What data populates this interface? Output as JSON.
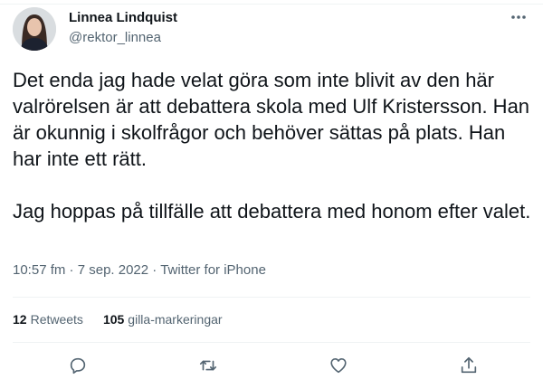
{
  "tweet": {
    "author_name": "Linnea Lindquist",
    "author_handle": "@rektor_linnea",
    "text": "Det enda jag hade velat göra som inte blivit av den här valrörelsen är att debattera skola med Ulf Kristersson. Han är okunnig i skolfrågor och behöver sättas på plats. Han har inte ett rätt.\n\nJag hoppas på tillfälle att debattera med honom efter valet.",
    "time": "10:57 fm",
    "separator": "·",
    "date": "7 sep. 2022",
    "source": "Twitter for iPhone"
  },
  "stats": {
    "retweets_count": "12",
    "retweets_label": "Retweets",
    "likes_count": "105",
    "likes_label": "gilla-markeringar"
  },
  "icons": {
    "more": "more-horizontal-icon",
    "reply": "reply-icon",
    "retweet": "retweet-icon",
    "like": "heart-icon",
    "share": "share-icon"
  },
  "colors": {
    "text": "#0f1419",
    "secondary": "#536471",
    "divider": "#eff3f4"
  }
}
